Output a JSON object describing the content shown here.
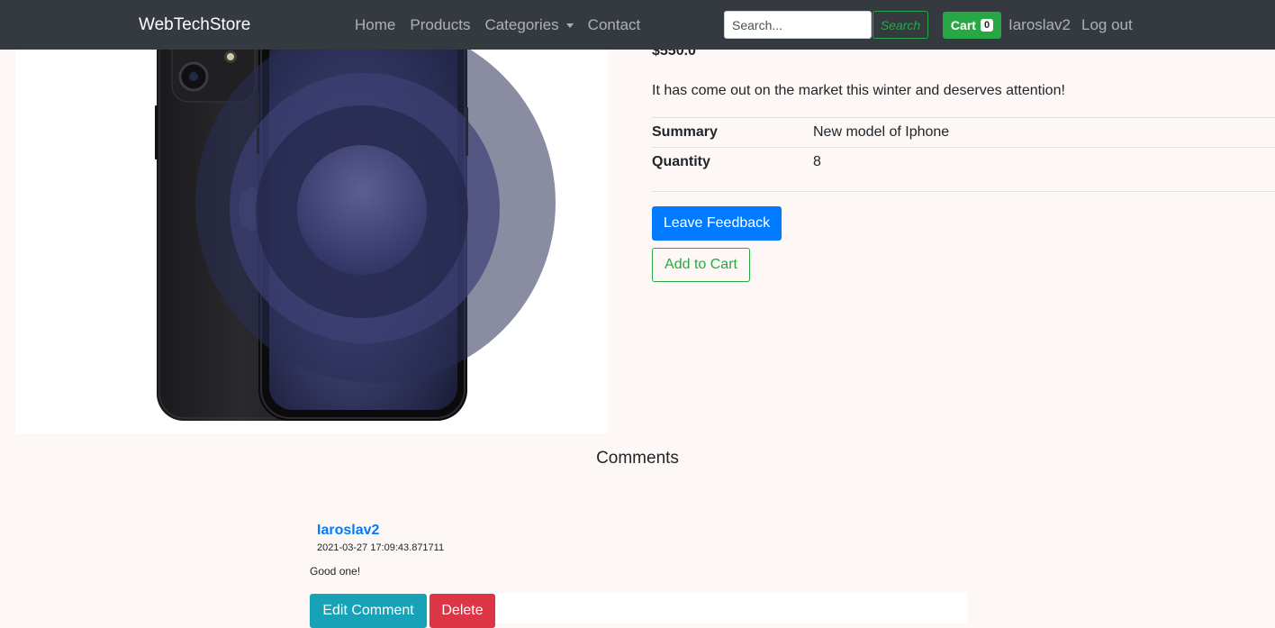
{
  "navbar": {
    "brand": "WebTechStore",
    "links": [
      {
        "label": "Home"
      },
      {
        "label": "Products"
      },
      {
        "label": "Categories"
      },
      {
        "label": "Contact"
      }
    ],
    "search": {
      "placeholder": "Search...",
      "value": "",
      "button_label": "Search"
    },
    "cart": {
      "label": "Cart",
      "count": "0"
    },
    "username": "Iaroslav2",
    "logout_label": "Log out"
  },
  "product": {
    "price": "$550.0",
    "description": "It has come out on the market this winter and deserves attention!",
    "specs": [
      {
        "key": "Summary",
        "value": "New model of Iphone"
      },
      {
        "key": "Quantity",
        "value": "8"
      }
    ],
    "feedback_label": "Leave Feedback",
    "add_to_cart_label": "Add to Cart"
  },
  "comments": {
    "title": "Comments",
    "items": [
      {
        "author": "Iaroslav2",
        "date": "2021-03-27 17:09:43.871711",
        "text": "Good one!",
        "edit_label": "Edit Comment",
        "delete_label": "Delete"
      }
    ]
  },
  "colors": {
    "navbar_bg": "#343a40",
    "primary": "#007bff",
    "success": "#28a745",
    "info": "#17a2b8",
    "danger": "#dc3545",
    "page_bg": "#fdf8f6"
  },
  "icons": {
    "dropdown": "caret-down-icon",
    "product_image": "iphone-product-image"
  }
}
